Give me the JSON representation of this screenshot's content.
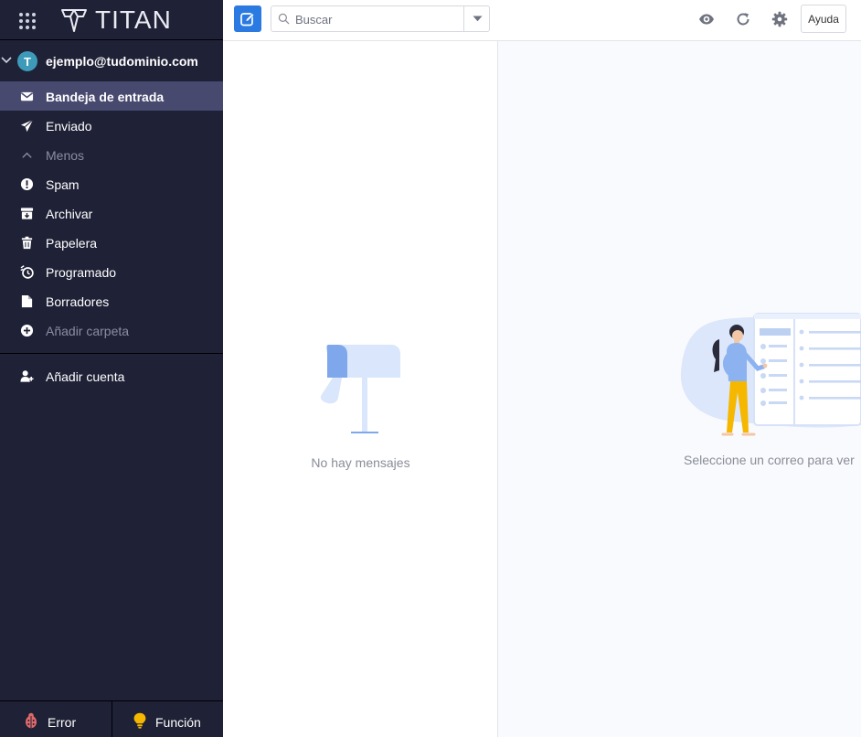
{
  "brand": {
    "logo_text": "TITAN"
  },
  "account": {
    "avatar_initial": "T",
    "email": "ejemplo@tudominio.com"
  },
  "folders": [
    {
      "label": "Bandeja de entrada",
      "icon": "inbox-icon",
      "active": true
    },
    {
      "label": "Enviado",
      "icon": "send-icon"
    },
    {
      "label": "Menos",
      "icon": "chevron-up-icon"
    },
    {
      "label": "Spam",
      "icon": "spam-icon"
    },
    {
      "label": "Archivar",
      "icon": "archive-icon"
    },
    {
      "label": "Papelera",
      "icon": "trash-icon"
    },
    {
      "label": "Programado",
      "icon": "clock-icon"
    },
    {
      "label": "Borradores",
      "icon": "draft-icon"
    },
    {
      "label": "Añadir carpeta",
      "icon": "add-folder-icon"
    }
  ],
  "add_account": {
    "label": "Añadir cuenta",
    "icon": "add-user-icon"
  },
  "footer": {
    "error_label": "Error",
    "feature_label": "Función"
  },
  "toolbar": {
    "search_placeholder": "Buscar",
    "help_label": "Ayuda"
  },
  "list": {
    "empty_text": "No hay mensajes"
  },
  "reading": {
    "empty_text": "Seleccione un correo para ver"
  },
  "colors": {
    "sidebar_bg": "#1f2136",
    "active_folder_bg": "#47496f",
    "accent": "#2a7ae2",
    "avatar_bg": "#3d9bb9"
  }
}
